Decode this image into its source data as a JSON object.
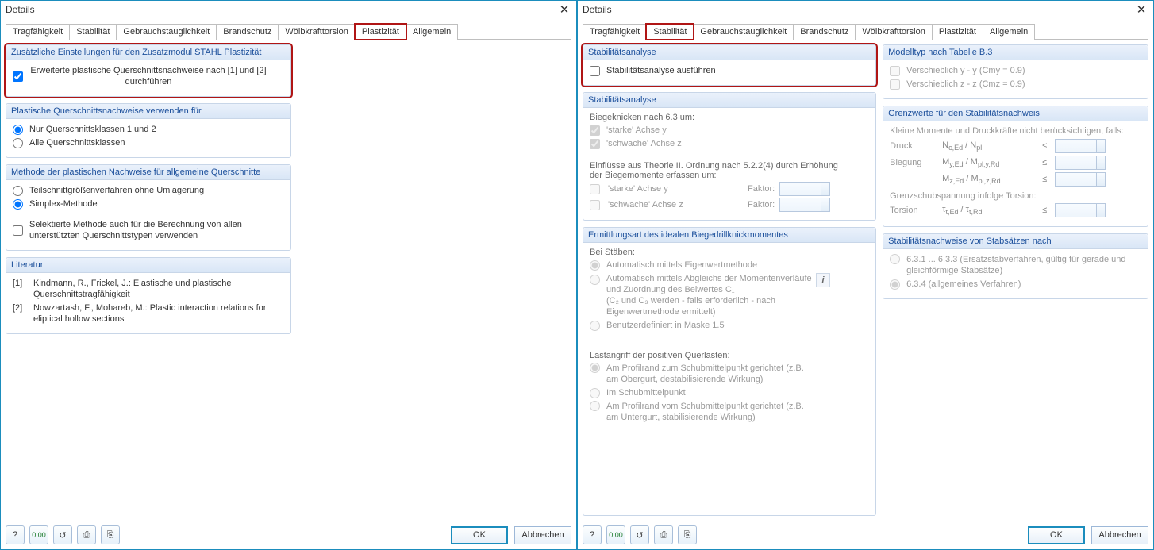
{
  "dialogs": [
    {
      "title": "Details",
      "close": "✕",
      "tabs": [
        "Tragfähigkeit",
        "Stabilität",
        "Gebrauchstauglichkeit",
        "Brandschutz",
        "Wölbkrafttorsion",
        "Plastizität",
        "Allgemein"
      ],
      "active_tab": 5,
      "hilite_tab": 5,
      "groups": {
        "addl": {
          "title": "Zusätzliche Einstellungen für den Zusatzmodul STAHL Plastizität",
          "check_label": "Erweiterte plastische Querschnittsnachweise nach [1] und [2] durchführen"
        },
        "usefor": {
          "title": "Plastische Querschnittsnachweise verwenden für",
          "r1": "Nur Querschnittsklassen 1 und 2",
          "r2": "Alle Querschnittsklassen"
        },
        "method": {
          "title": "Methode der plastischen Nachweise für allgemeine Querschnitte",
          "r1": "Teilschnittgrößenverfahren ohne Umlagerung",
          "r2": "Simplex-Methode",
          "chk": "Selektierte Methode auch für die Berechnung von allen unterstützten Querschnittstypen verwenden"
        },
        "lit": {
          "title": "Literatur",
          "i1n": "[1]",
          "i1t": "Kindmann, R., Frickel, J.: Elastische und plastische Querschnittstragfähigkeit",
          "i2n": "[2]",
          "i2t": "Nowzartash, F., Mohareb, M.: Plastic interaction relations for eliptical hollow sections"
        }
      }
    },
    {
      "title": "Details",
      "close": "✕",
      "tabs": [
        "Tragfähigkeit",
        "Stabilität",
        "Gebrauchstauglichkeit",
        "Brandschutz",
        "Wölbkrafttorsion",
        "Plastizität",
        "Allgemein"
      ],
      "active_tab": 1,
      "hilite_tab": 1,
      "left": {
        "run": {
          "title": "Stabilitätsanalyse",
          "chk": "Stabilitätsanalyse ausführen"
        },
        "ana": {
          "title": "Stabilitätsanalyse",
          "sub1": "Biegeknicken nach 6.3 um:",
          "c1": "'starke' Achse y",
          "c2": "'schwache' Achse z",
          "sub2": "Einflüsse aus Theorie II. Ordnung nach 5.2.2(4) durch Erhöhung der Biegemomente erfassen um:",
          "f1": "'starke' Achse y",
          "f2": "'schwache' Achse z",
          "faktor": "Faktor:"
        },
        "erm": {
          "title": "Ermittlungsart des idealen Biegedrillknickmomentes",
          "sub": "Bei Stäben:",
          "r1": "Automatisch mittels Eigenwertmethode",
          "r2a": "Automatisch mittels Abgleichs der Momentenverläufe und Zuordnung des Beiwertes C₁",
          "r2b": "(C₂ und C₃ werden - falls erforderlich - nach Eigenwertmethode ermittelt)",
          "r3": "Benutzerdefiniert in Maske 1.5",
          "sub2": "Lastangriff der positiven Querlasten:",
          "la1": "Am Profilrand zum Schubmittelpunkt gerichtet (z.B. am Obergurt, destabilisierende Wirkung)",
          "la2": "Im Schubmittelpunkt",
          "la3": "Am Profilrand vom Schubmittelpunkt gerichtet (z.B. am Untergurt, stabilisierende Wirkung)"
        }
      },
      "right": {
        "model": {
          "title": "Modelltyp nach Tabelle B.3",
          "c1": "Verschieblich y - y (Cmy = 0.9)",
          "c2": "Verschieblich z - z (Cmz = 0.9)"
        },
        "limits": {
          "title": "Grenzwerte für den Stabilitätsnachweis",
          "intro": "Kleine Momente und Druckkräfte nicht berücksichtigen, falls:",
          "rows": [
            {
              "lab": "Druck",
              "expr": "Nc,Ed / Npl",
              "op": "≤"
            },
            {
              "lab": "Biegung",
              "expr": "My,Ed / Mpl,y,Rd",
              "op": "≤"
            },
            {
              "lab": "",
              "expr": "Mz,Ed / Mpl,z,Rd",
              "op": "≤"
            }
          ],
          "tors_intro": "Grenzschubspannung infolge Torsion:",
          "tors": {
            "lab": "Torsion",
            "expr": "τt,Ed / τt,Rd",
            "op": "≤"
          }
        },
        "sets": {
          "title": "Stabilitätsnachweise von Stabsätzen nach",
          "r1": "6.3.1 ... 6.3.3  (Ersatzstabverfahren, gültig für gerade und gleichförmige Stabsätze)",
          "r2": "6.3.4 (allgemeines Verfahren)"
        }
      }
    }
  ],
  "buttons": {
    "ok": "OK",
    "cancel": "Abbrechen"
  },
  "toolbar_icons": [
    "?",
    "0.00",
    "↺",
    "⎙",
    "⎘"
  ]
}
